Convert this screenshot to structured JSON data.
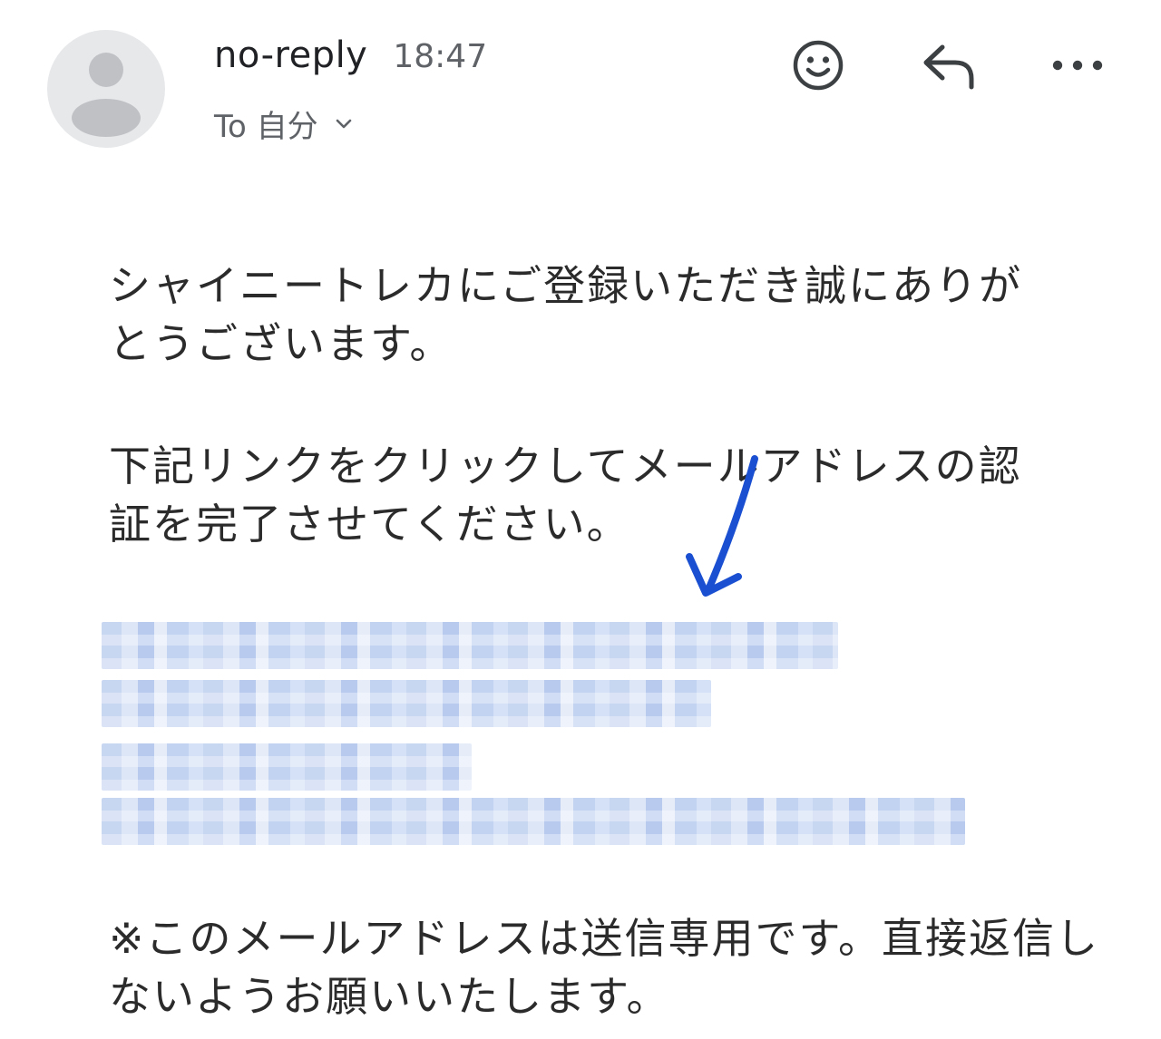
{
  "header": {
    "sender_name": "no-reply",
    "time": "18:47",
    "recipient": "To 自分"
  },
  "icons": {
    "avatar": "person-icon",
    "emoji": "smiley-icon",
    "reply": "reply-icon",
    "more": "more-horizontal-icon",
    "expand": "chevron-down-icon",
    "annotation": "arrow-icon"
  },
  "colors": {
    "arrow": "#1a4fd1",
    "link_blur": "#c7d6f1",
    "avatar_bg": "#e7e8ea"
  },
  "message": {
    "paragraph1": "シャイニートレカにご登録いただき誠にありがとうございます。",
    "paragraph2": "下記リンクをクリックしてメールアドレスの認証を完了させてください。",
    "paragraph3": "※このメールアドレスは送信専用です。直接返信しないようお願いいたします。"
  }
}
